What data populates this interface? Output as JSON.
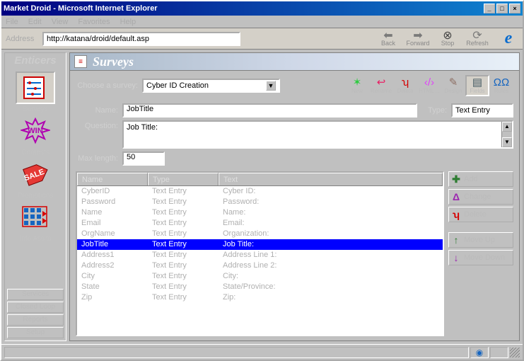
{
  "window": {
    "title": "Market Droid - Microsoft Internet Explorer"
  },
  "menu": [
    "File",
    "Edit",
    "View",
    "Favorites",
    "Help"
  ],
  "address": {
    "label": "Address",
    "value": "http://katana/droid/default.asp"
  },
  "nav": {
    "back": "Back",
    "forward": "Forward",
    "stop": "Stop",
    "refresh": "Refresh"
  },
  "sidebar": {
    "header": "Enticers",
    "items": [
      {
        "label": "Surveys"
      },
      {
        "label": "Contests"
      },
      {
        "label": "Promotions"
      },
      {
        "label": "Info Ass'ts"
      }
    ],
    "buttons": [
      "Services",
      "Closed Loop",
      "Reports",
      "Setup"
    ]
  },
  "page": {
    "title": "Surveys",
    "choose_label": "Choose a survey:",
    "survey_value": "Cyber ID Creation",
    "tools": [
      {
        "label": "New",
        "color": "#2ecc40",
        "glyph": "✶"
      },
      {
        "label": "Rename",
        "color": "#e91e63",
        "glyph": "↩"
      },
      {
        "label": "Delete",
        "color": "#d50000",
        "glyph": "ʮ"
      },
      {
        "label": "HTML…",
        "color": "#e040fb",
        "glyph": "‹/›"
      },
      {
        "label": "Design",
        "color": "#8d6e63",
        "glyph": "✎"
      },
      {
        "label": "Fields",
        "color": "#455a64",
        "glyph": "▤",
        "active": true
      },
      {
        "label": "Rules",
        "color": "#1565c0",
        "glyph": "ΩΩ"
      }
    ],
    "name_label": "Name:",
    "name_value": "JobTitle",
    "type_label": "Type:",
    "type_value": "Text Entry",
    "question_label": "Question:",
    "question_value": "Job Title:",
    "maxlen_label": "Max length:",
    "maxlen_value": "50",
    "cols": {
      "c1": "Name",
      "c2": "Type",
      "c3": "Text"
    },
    "rows": [
      {
        "name": "CyberID",
        "type": "Text Entry",
        "text": "Cyber ID:"
      },
      {
        "name": "Password",
        "type": "Text Entry",
        "text": "Password:"
      },
      {
        "name": "Name",
        "type": "Text Entry",
        "text": "Name:"
      },
      {
        "name": "Email",
        "type": "Text Entry",
        "text": "Email:"
      },
      {
        "name": "OrgName",
        "type": "Text Entry",
        "text": "Organization:"
      },
      {
        "name": "JobTitle",
        "type": "Text Entry",
        "text": "Job Title:",
        "selected": true
      },
      {
        "name": "Address1",
        "type": "Text Entry",
        "text": "Address Line 1:"
      },
      {
        "name": "Address2",
        "type": "Text Entry",
        "text": "Address Line 2:"
      },
      {
        "name": "City",
        "type": "Text Entry",
        "text": "City:"
      },
      {
        "name": "State",
        "type": "Text Entry",
        "text": "State/Province:"
      },
      {
        "name": "Zip",
        "type": "Text Entry",
        "text": "Zip:"
      }
    ],
    "actions": {
      "add": "Add",
      "change": "Change",
      "delete": "Delete",
      "moveup": "Move Up",
      "movedown": "Move Down"
    }
  }
}
